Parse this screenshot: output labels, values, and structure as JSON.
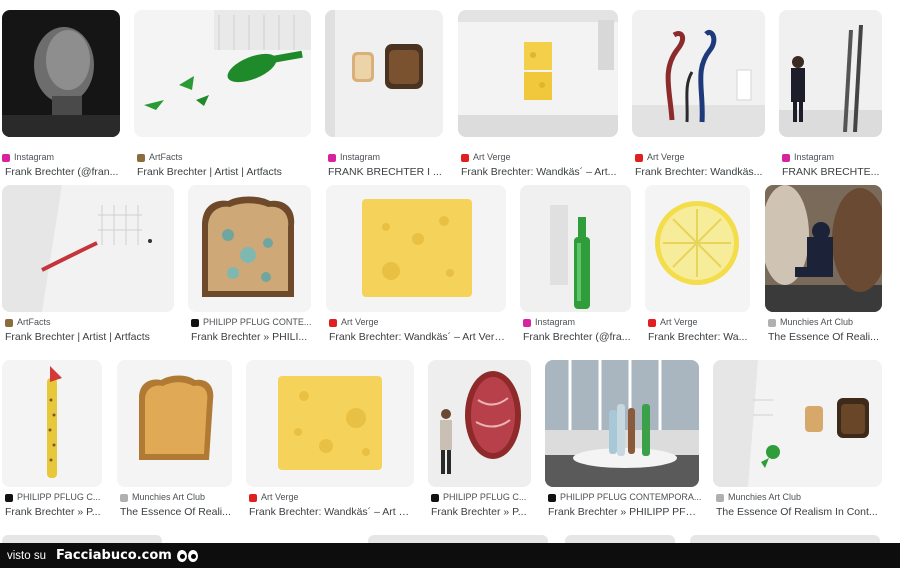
{
  "tiles": [
    {
      "source": "Instagram",
      "title": "Frank Brechter (@fran...",
      "fav": "#d6249f",
      "img": "portrait-photo"
    },
    {
      "source": "ArtFacts",
      "title": "Frank Brechter | Artist | Artfacts",
      "fav": "#8a6d3b",
      "img": "broken-bottle-photo"
    },
    {
      "source": "Instagram",
      "title": "FRANK BRECHTER I ...",
      "fav": "#d6249f",
      "img": "toast-wall-photo"
    },
    {
      "source": "Art Verge",
      "title": "Frank Brechter: Wandkäs´ – Art...",
      "fav": "#e02020",
      "img": "cheese-wall-photo"
    },
    {
      "source": "Art Verge",
      "title": "Frank Brechter: Wandkäs...",
      "fav": "#e02020",
      "img": "tentacle-sculpture-photo"
    },
    {
      "source": "Instagram",
      "title": "FRANK BRECHTE...",
      "fav": "#d6249f",
      "img": "gallery-visitor-photo"
    },
    {
      "source": "ArtFacts",
      "title": "Frank Brechter | Artist | Artfacts",
      "fav": "#8a6d3b",
      "img": "gallery-wall-photo"
    },
    {
      "source": "PHILIPP PFLUG CONTE...",
      "title": "Frank Brechter » PHILI...",
      "fav": "#111111",
      "img": "mouldy-bread-photo"
    },
    {
      "source": "Art Verge",
      "title": "Frank Brechter: Wandkäs´ – Art Verge",
      "fav": "#e02020",
      "img": "cheese-slice-photo"
    },
    {
      "source": "Instagram",
      "title": "Frank Brechter (@fra...",
      "fav": "#d6249f",
      "img": "green-bottle-photo"
    },
    {
      "source": "Art Verge",
      "title": "Frank Brechter: Wa...",
      "fav": "#e02020",
      "img": "lemon-slice-photo"
    },
    {
      "source": "Munchies Art Club",
      "title": "The Essence Of Reali...",
      "fav": "#b0b0b0",
      "img": "sculptor-photo"
    },
    {
      "source": "PHILIPP PFLUG C...",
      "title": "Frank Brechter » P...",
      "fav": "#111111",
      "img": "corn-sculpture-photo"
    },
    {
      "source": "Munchies Art Club",
      "title": "The Essence Of Reali...",
      "fav": "#b0b0b0",
      "img": "toast-photo"
    },
    {
      "source": "Art Verge",
      "title": "Frank Brechter: Wandkäs´ – Art V...",
      "fav": "#e02020",
      "img": "cheese-wall-photo-2"
    },
    {
      "source": "PHILIPP PFLUG C...",
      "title": "Frank Brechter » P...",
      "fav": "#111111",
      "img": "steak-wall-photo"
    },
    {
      "source": "PHILIPP PFLUG CONTEMPORA...",
      "title": "Frank Brechter » PHILIPP PFL...",
      "fav": "#111111",
      "img": "glass-bottles-photo"
    },
    {
      "source": "Munchies Art Club",
      "title": "The Essence Of Realism In Cont...",
      "fav": "#b0b0b0",
      "img": "gallery-toast-photo"
    }
  ],
  "footer": {
    "visto_su": "visto su",
    "brand": "Facciabuco.com"
  }
}
